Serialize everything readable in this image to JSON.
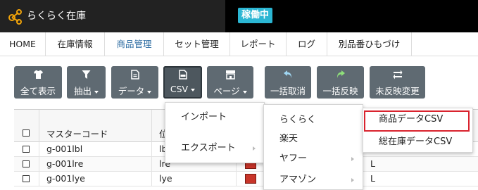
{
  "header": {
    "title": "らくらく在庫",
    "status": "稼働中",
    "logo_icon": "network-nodes-icon",
    "brand_color": "#f0a30a",
    "status_color": "#2bb6d3"
  },
  "nav": {
    "items": [
      {
        "label": "HOME"
      },
      {
        "label": "在庫情報"
      },
      {
        "label": "商品管理"
      },
      {
        "label": "セット管理"
      },
      {
        "label": "レポート"
      },
      {
        "label": "ログ"
      },
      {
        "label": "別品番ひもづけ"
      }
    ],
    "active": "商品管理"
  },
  "toolbar": {
    "buttons": [
      {
        "label": "全て表示",
        "icon": "shirt-icon",
        "dropdown": false
      },
      {
        "label": "抽出",
        "icon": "filter-icon",
        "dropdown": true
      },
      {
        "label": "データ",
        "icon": "document-icon",
        "dropdown": true
      },
      {
        "label": "CSV",
        "icon": "csv-file-icon",
        "dropdown": true
      },
      {
        "label": "ページ",
        "icon": "storefront-icon",
        "dropdown": true
      },
      {
        "label": "一括取消",
        "icon": "undo-arrow-icon",
        "dropdown": false
      },
      {
        "label": "一括反映",
        "icon": "redo-arrow-icon",
        "dropdown": false
      },
      {
        "label": "未反映変更",
        "icon": "swap-arrows-icon",
        "dropdown": false
      }
    ],
    "active": "CSV"
  },
  "table": {
    "headers": [
      "",
      "マスターコード",
      "位"
    ],
    "rows": [
      {
        "code": "g-001lbl",
        "col3": "lb",
        "col5": "L"
      },
      {
        "code": "g-001lre",
        "col3": "lre",
        "col5": "L"
      },
      {
        "code": "g-001lye",
        "col3": "lye",
        "col5": "L"
      }
    ]
  },
  "csv_menu": {
    "items": [
      {
        "label": "インポート"
      },
      {
        "label": "エクスポート"
      }
    ]
  },
  "export_submenu": {
    "items": [
      {
        "label": "らくらく"
      },
      {
        "label": "楽天"
      },
      {
        "label": "ヤフー"
      },
      {
        "label": "アマゾン"
      }
    ]
  },
  "rakuraku_submenu": {
    "items": [
      {
        "label": "商品データCSV"
      },
      {
        "label": "総在庫データCSV"
      }
    ],
    "highlighted": "商品データCSV",
    "highlight_color": "#d9232e"
  }
}
